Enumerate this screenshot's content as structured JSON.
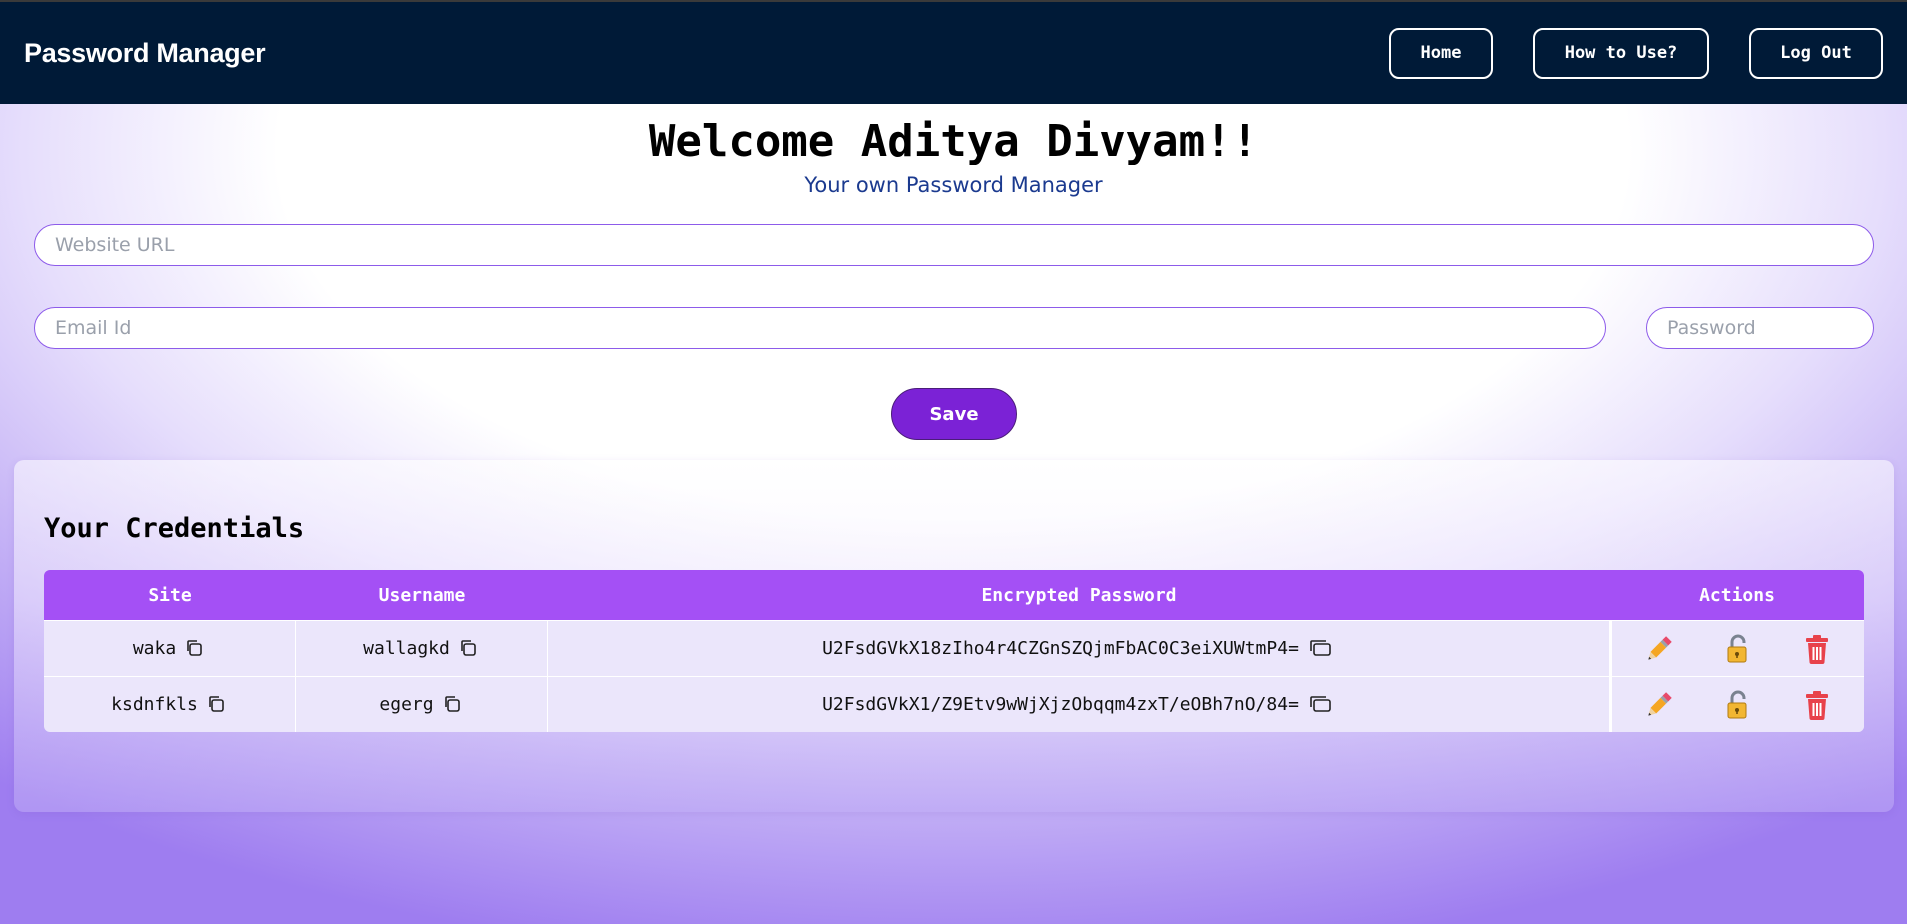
{
  "navbar": {
    "brand": "Password Manager",
    "buttons": [
      "Home",
      "How to Use?",
      "Log Out"
    ]
  },
  "hero": {
    "title": "Welcome Aditya Divyam!!",
    "subtitle": "Your own Password Manager"
  },
  "form": {
    "website_placeholder": "Website URL",
    "email_placeholder": "Email Id",
    "password_placeholder": "Password",
    "save_label": "Save"
  },
  "credentials": {
    "heading": "Your Credentials",
    "columns": [
      "Site",
      "Username",
      "Encrypted Password",
      "Actions"
    ],
    "rows": [
      {
        "site": "waka",
        "username": "wallagkd",
        "password": "U2FsdGVkX18zIho4r4CZGnSZQjmFbAC0C3eiXUWtmP4="
      },
      {
        "site": "ksdnfkls",
        "username": "egerg",
        "password": "U2FsdGVkX1/Z9Etv9wWjXjzObqqm4zxT/eOBh7nO/84="
      }
    ],
    "action_icons": [
      "pencil-icon",
      "unlock-icon",
      "trash-icon"
    ]
  },
  "colors": {
    "navbar": "#001a37",
    "accent": "#7b22d6",
    "table_header": "#a450f5",
    "subtitle": "#1b3a8f"
  }
}
